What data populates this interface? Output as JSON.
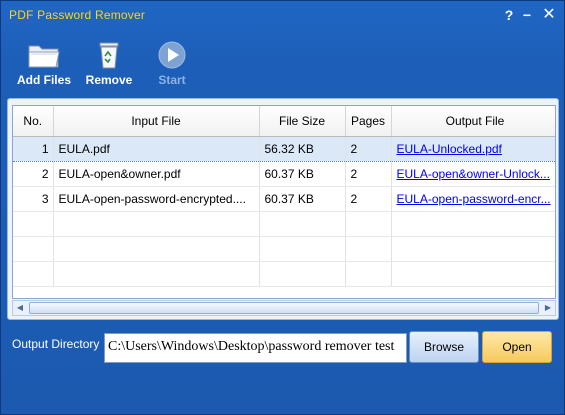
{
  "window": {
    "title": "PDF Password Remover",
    "help_label": "?",
    "minimize_label": "−",
    "close_label": "✕"
  },
  "toolbar": {
    "add_files_label": "Add Files",
    "remove_label": "Remove",
    "start_label": "Start",
    "icons": [
      "folder-icon",
      "recycle-bin-icon",
      "play-icon"
    ]
  },
  "table": {
    "columns": [
      "No.",
      "Input File",
      "File Size",
      "Pages",
      "Output File"
    ],
    "rows": [
      {
        "no": "1",
        "input": "EULA.pdf",
        "size": "56.32 KB",
        "pages": "2",
        "output": "EULA-Unlocked.pdf",
        "selected": true
      },
      {
        "no": "2",
        "input": "EULA-open&owner.pdf",
        "size": "60.37 KB",
        "pages": "2",
        "output": "EULA-open&owner-Unlock..."
      },
      {
        "no": "3",
        "input": "EULA-open-password-encrypted....",
        "size": "60.37 KB",
        "pages": "2",
        "output": "EULA-open-password-encr..."
      }
    ]
  },
  "output": {
    "label": "Output Directory",
    "path": "C:\\Users\\Windows\\Desktop\\password remover test",
    "browse_label": "Browse",
    "open_label": "Open"
  },
  "colors": {
    "window_bg": "#1c5ab0",
    "title_text": "#ffd21a",
    "open_button": "#f6c95d",
    "browse_button": "#bcd3f1",
    "selection": "#dbe8f8",
    "link": "#0000ee"
  }
}
